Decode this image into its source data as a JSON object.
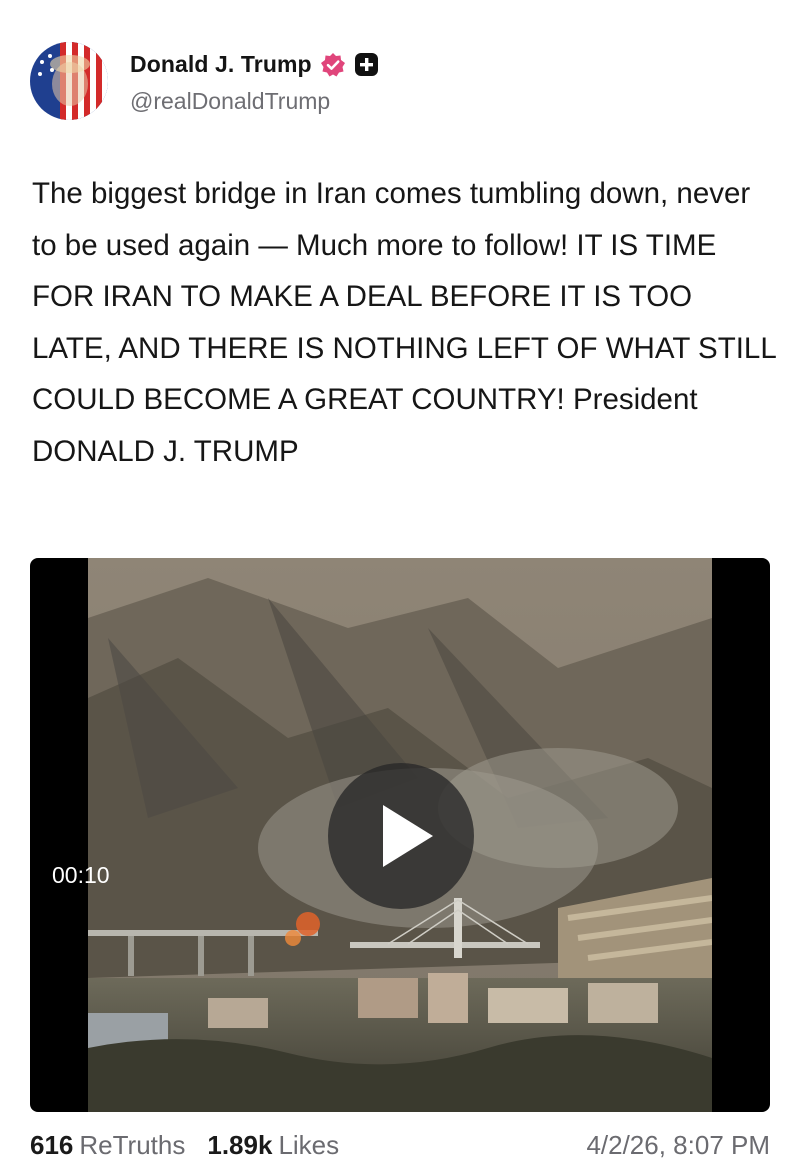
{
  "author": {
    "display_name": "Donald J. Trump",
    "handle": "@realDonaldTrump",
    "verified_icon": "verified-badge-icon",
    "plus_icon": "plus-square-icon",
    "accent_color": "#e0457b"
  },
  "post": {
    "text": "The biggest bridge in Iran comes tumbling down, never to be used again — Much more to follow! IT IS TIME FOR IRAN TO MAKE A DEAL BEFORE IT IS TOO LATE, AND THERE IS NOTHING LEFT OF WHAT STILL COULD BECOME A GREAT COUNTRY! President DONALD J. TRUMP"
  },
  "media": {
    "duration": "00:10",
    "play_icon": "play-icon"
  },
  "stats": {
    "retruths_count": "616",
    "retruths_label": "ReTruths",
    "likes_count": "1.89k",
    "likes_label": "Likes",
    "timestamp": "4/2/26, 8:07 PM"
  }
}
